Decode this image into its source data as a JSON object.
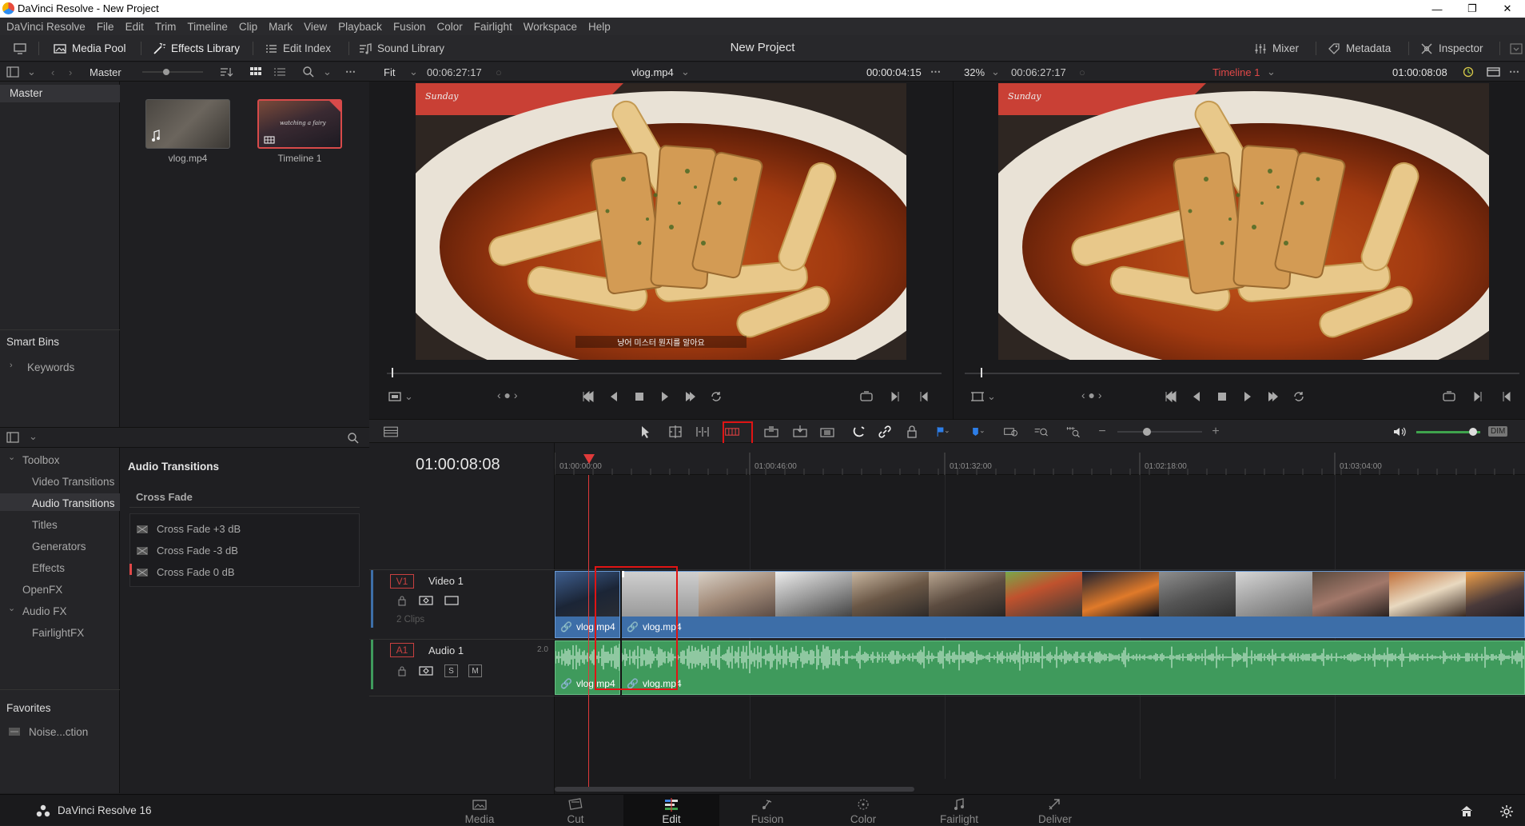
{
  "window": {
    "title": "DaVinci Resolve - New Project"
  },
  "menu": [
    "DaVinci Resolve",
    "File",
    "Edit",
    "Trim",
    "Timeline",
    "Clip",
    "Mark",
    "View",
    "Playback",
    "Fusion",
    "Color",
    "Fairlight",
    "Workspace",
    "Help"
  ],
  "toolbar": {
    "media_pool": "Media Pool",
    "effects_library": "Effects Library",
    "edit_index": "Edit Index",
    "sound_library": "Sound Library",
    "project_title": "New Project",
    "mixer": "Mixer",
    "metadata": "Metadata",
    "inspector": "Inspector"
  },
  "bin_header": {
    "bin_name": "Master"
  },
  "bins": {
    "master": "Master",
    "smart_bins": "Smart Bins",
    "keywords": "Keywords"
  },
  "media_pool": {
    "clips": [
      {
        "name": "vlog.mp4"
      },
      {
        "name": "Timeline 1"
      }
    ],
    "clip_overlay_text": "watching a fairy"
  },
  "source_viewer": {
    "zoom": "Fit",
    "duration": "00:06:27:17",
    "clip_name": "vlog.mp4",
    "timecode": "00:00:04:15",
    "subtitle": "냥어 미스터 뭔지를 알아요",
    "watermark": "Sunday"
  },
  "timeline_viewer": {
    "zoom": "32%",
    "duration": "00:06:27:17",
    "timeline_name": "Timeline 1",
    "timecode": "01:00:08:08",
    "watermark": "Sunday"
  },
  "effects": {
    "tree": {
      "toolbox": "Toolbox",
      "video_transitions": "Video Transitions",
      "audio_transitions": "Audio Transitions",
      "titles": "Titles",
      "generators": "Generators",
      "effects": "Effects",
      "openfx": "OpenFX",
      "audio_fx": "Audio FX",
      "fairlight_fx": "FairlightFX"
    },
    "list_title": "Audio Transitions",
    "group_title": "Cross Fade",
    "items": [
      "Cross Fade +3 dB",
      "Cross Fade -3 dB",
      "Cross Fade 0 dB"
    ],
    "favorites": "Favorites",
    "favorite_item": "Noise...ction"
  },
  "timeline": {
    "timecode": "01:00:08:08",
    "ruler": [
      "01:00:00:00",
      "01:00:46:00",
      "01:01:32:00",
      "01:02:18:00",
      "01:03:04:00"
    ],
    "tracks": {
      "v1_tag": "V1",
      "v1_name": "Video 1",
      "v1_info": "2 Clips",
      "a1_tag": "A1",
      "a1_name": "Audio 1",
      "a1_channels": "2.0",
      "solo": "S",
      "mute": "M"
    },
    "clips": [
      "vlog.mp4",
      "vlog.mp4"
    ],
    "dim": "DIM"
  },
  "pages": [
    "Media",
    "Cut",
    "Edit",
    "Fusion",
    "Color",
    "Fairlight",
    "Deliver"
  ],
  "active_page": "Edit",
  "app_version": "DaVinci Resolve 16",
  "colors": {
    "accent_red": "#e01414",
    "video_clip": "#3d6ea8",
    "audio_clip": "#3f9a5c",
    "playhead": "#e03a3a",
    "timeline_name": "#e04848"
  }
}
